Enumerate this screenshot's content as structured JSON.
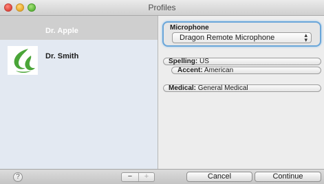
{
  "window": {
    "title": "Profiles"
  },
  "sidebar": {
    "profiles": [
      {
        "name": "Dr. Apple",
        "selected": true
      },
      {
        "name": "Dr. Smith",
        "icon": "dragon-logo-icon"
      }
    ]
  },
  "microphone": {
    "label": "Microphone",
    "selected": "Dragon Remote Microphone"
  },
  "spelling": {
    "label": "Spelling:",
    "value": "US"
  },
  "accent": {
    "label": "Accent:",
    "value": "American"
  },
  "medical": {
    "label": "Medical:",
    "value": "General Medical"
  },
  "toolbar": {
    "help_label": "?",
    "remove_label": "−",
    "add_label": "+",
    "cancel_label": "Cancel",
    "continue_label": "Continue"
  },
  "colors": {
    "focus_ring": "#6aa6d9",
    "sidebar_bg": "#e3e9f2",
    "logo_green": "#4aa538"
  }
}
